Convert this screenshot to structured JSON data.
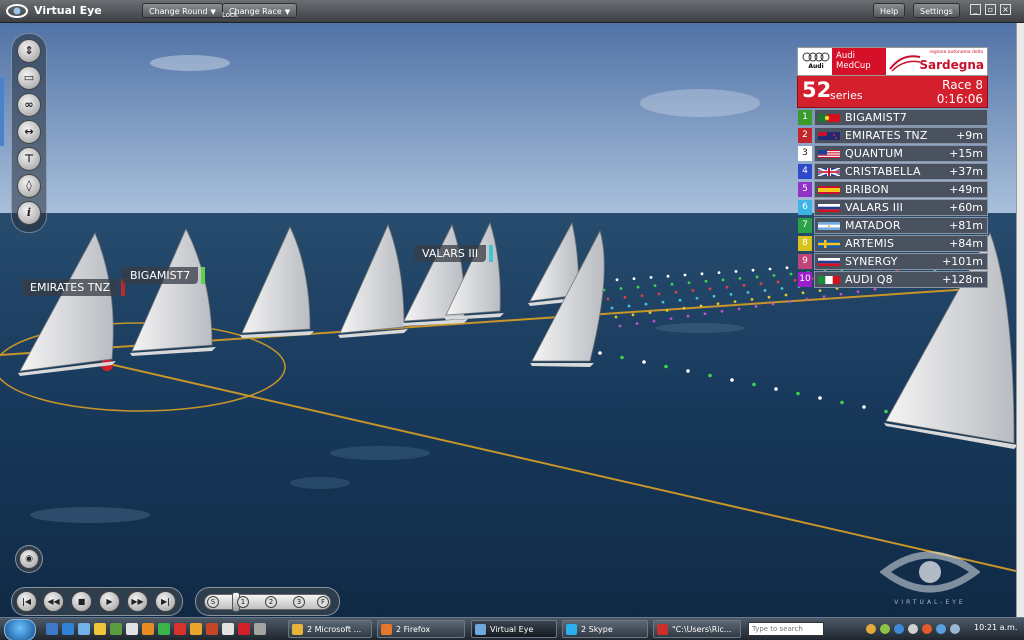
{
  "window": {
    "title": "Virtual Eye",
    "change_round": "Change Round",
    "change_race": "Change Race",
    "lock": "Lock",
    "help": "Help",
    "settings": "Settings"
  },
  "toolstrip": {
    "tools": [
      "camera-move-icon",
      "top-view-icon",
      "two-boats-icon",
      "width-arrows-icon",
      "chase-cam-icon",
      "boat-pair-icon",
      "info-icon"
    ]
  },
  "leaderboard": {
    "sponsor_audi": "Audi",
    "sponsor_medcup": "Audi MedCup",
    "sponsor_region_small": "regione autonoma della",
    "sponsor_region": "Sardegna",
    "series_number": "52",
    "series_word": "series",
    "race": "Race 8",
    "elapsed": "0:16:06",
    "rows": [
      {
        "pos": "1",
        "name": "BIGAMIST7",
        "gap": "",
        "flag": "portugal",
        "pos_color": "#3a9a2a"
      },
      {
        "pos": "2",
        "name": "EMIRATES TNZ",
        "gap": "+9m",
        "flag": "new-zealand",
        "pos_color": "#c3262a"
      },
      {
        "pos": "3",
        "name": "QUANTUM",
        "gap": "+15m",
        "flag": "usa",
        "pos_color": "#ffffff"
      },
      {
        "pos": "4",
        "name": "CRISTABELLA",
        "gap": "+37m",
        "flag": "uk",
        "pos_color": "#2e49c9"
      },
      {
        "pos": "5",
        "name": "BRIBON",
        "gap": "+49m",
        "flag": "spain",
        "pos_color": "#9132c9"
      },
      {
        "pos": "6",
        "name": "VALARS III",
        "gap": "+60m",
        "flag": "russia",
        "pos_color": "#3eb4e6"
      },
      {
        "pos": "7",
        "name": "MATADOR",
        "gap": "+81m",
        "flag": "argentina",
        "pos_color": "#2aa245"
      },
      {
        "pos": "8",
        "name": "ARTEMIS",
        "gap": "+84m",
        "flag": "sweden",
        "pos_color": "#d8c21e"
      },
      {
        "pos": "9",
        "name": "SYNERGY",
        "gap": "+101m",
        "flag": "russia",
        "pos_color": "#c0437a"
      },
      {
        "pos": "10",
        "name": "AUDI Q8",
        "gap": "+128m",
        "flag": "italy",
        "pos_color": "#9c1ec9"
      }
    ]
  },
  "boat_labels": [
    {
      "name": "EMIRATES TNZ",
      "tick_color": "#c3262a"
    },
    {
      "name": "BIGAMIST7",
      "tick_color": "#5fd14c"
    },
    {
      "name": "VALARS III",
      "tick_color": "#3ec6d6"
    }
  ],
  "playback": {
    "speed_marks": [
      "S",
      "1",
      "2",
      "3",
      "F"
    ]
  },
  "watermark": "VIRTUAL-EYE",
  "taskbar": {
    "tasks": [
      "2 Microsoft ...",
      "2 Firefox",
      "Virtual Eye",
      "2 Skype",
      "\"C:\\Users\\Ric..."
    ],
    "search_placeholder": "Type to search",
    "clock": "10:21 a.m."
  }
}
